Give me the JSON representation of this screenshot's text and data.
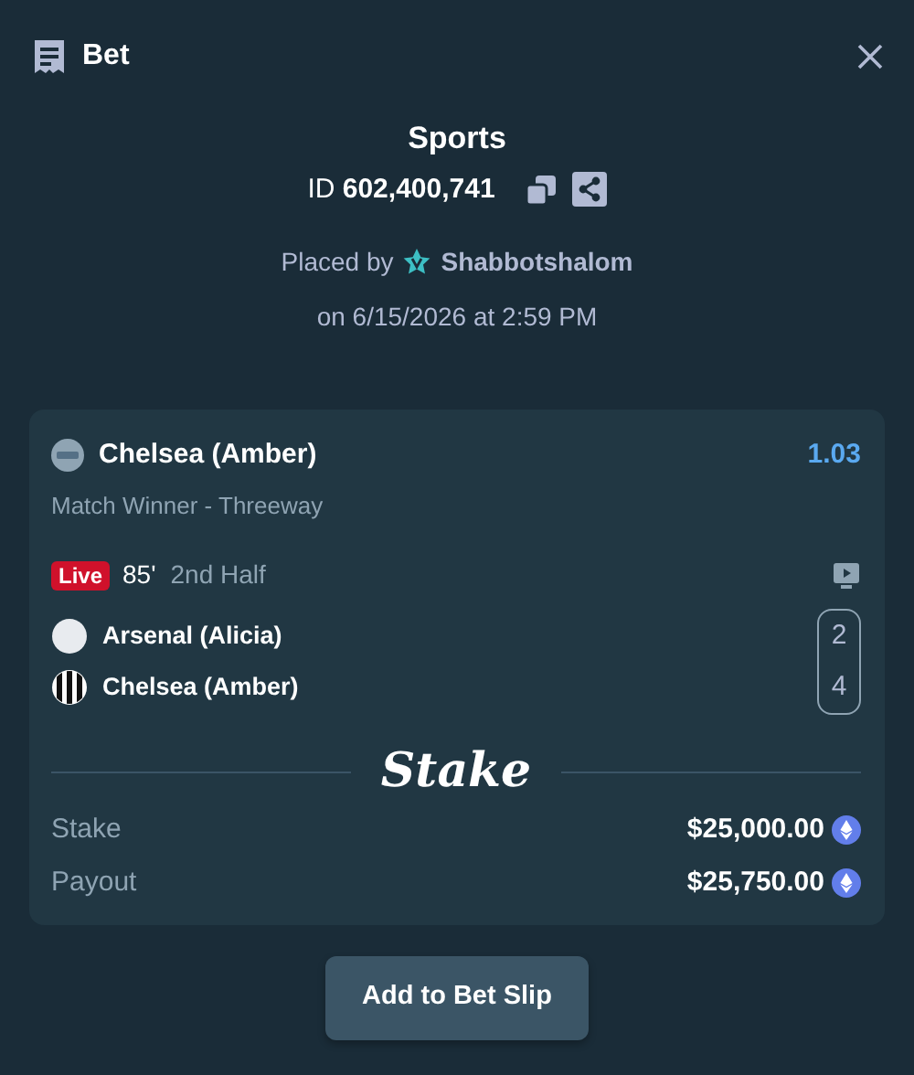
{
  "header": {
    "title": "Bet"
  },
  "bet": {
    "category": "Sports",
    "id_label": "ID",
    "id": "602,400,741",
    "placed_by": "Placed by",
    "user": "Shabbotshalom",
    "date": "on 6/15/2026 at 2:59 PM"
  },
  "selection": {
    "name": "Chelsea (Amber)",
    "odds": "1.03",
    "market": "Match Winner - Threeway",
    "live_badge": "Live",
    "minute": "85'",
    "period": "2nd Half",
    "teams": [
      {
        "name": "Arsenal (Alicia)",
        "kind": "plain",
        "score": "2"
      },
      {
        "name": "Chelsea (Amber)",
        "kind": "striped",
        "score": "4"
      }
    ]
  },
  "brand": "Stake",
  "amounts": [
    {
      "label": "Stake",
      "value": "$25,000.00"
    },
    {
      "label": "Payout",
      "value": "$25,750.00"
    }
  ],
  "button": "Add to Bet Slip"
}
